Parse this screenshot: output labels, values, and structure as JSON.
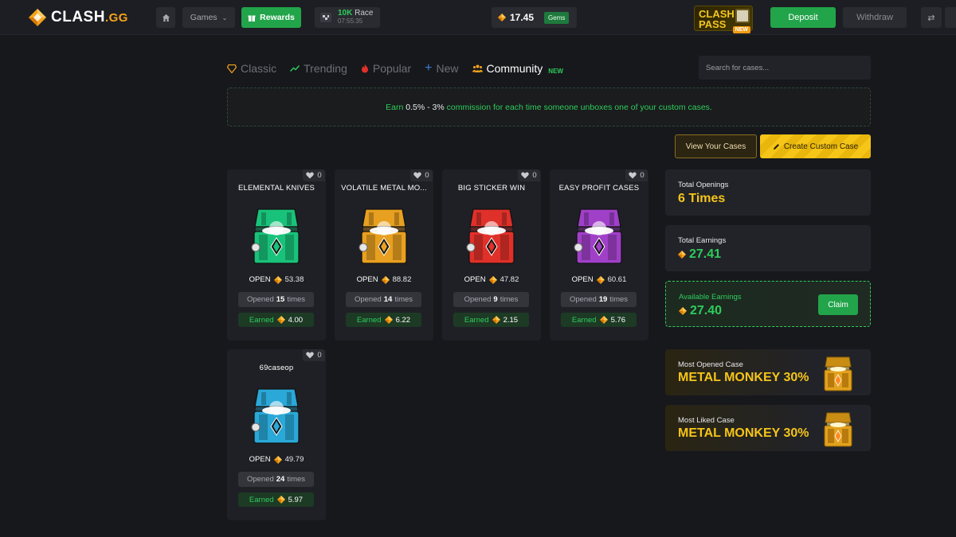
{
  "brand": {
    "name": "CLASH",
    "suffix": ".GG"
  },
  "header": {
    "games_label": "Games",
    "rewards_label": "Rewards",
    "race_prize": "10K",
    "race_label": "Race",
    "race_timer": "07:55:35",
    "balance": "17.45",
    "gems_label": "Gems",
    "pass_line1": "CLASH",
    "pass_line2": "PASS",
    "pass_new": "NEW",
    "deposit_label": "Deposit",
    "withdraw_label": "Withdraw"
  },
  "tabs": [
    {
      "label": "Classic",
      "icon": "diamond-icon",
      "active": false
    },
    {
      "label": "Trending",
      "icon": "trend-up-icon",
      "active": false
    },
    {
      "label": "Popular",
      "icon": "fire-icon",
      "active": false
    },
    {
      "label": "New",
      "icon": "plus-icon",
      "active": false
    },
    {
      "label": "Community",
      "icon": "users-icon",
      "active": true,
      "tag": "NEW"
    }
  ],
  "search": {
    "placeholder": "Search for cases..."
  },
  "banner": {
    "prefix": "Earn",
    "highlight": "0.5% - 3%",
    "suffix": "commission for each time someone unboxes one of your custom cases."
  },
  "actions": {
    "view_cases": "View Your Cases",
    "create_case": "Create Custom Case"
  },
  "cases": [
    {
      "title": "ELEMENTAL KNIVES",
      "likes": "0",
      "open_label": "OPEN",
      "price": "53.38",
      "opened_prefix": "Opened",
      "opened_count": "15",
      "opened_suffix": "times",
      "earned_label": "Earned",
      "earned": "4.00",
      "color": "#19c27a"
    },
    {
      "title": "VOLATILE METAL MO...",
      "likes": "0",
      "open_label": "OPEN",
      "price": "88.82",
      "opened_prefix": "Opened",
      "opened_count": "14",
      "opened_suffix": "times",
      "earned_label": "Earned",
      "earned": "6.22",
      "color": "#e8a020"
    },
    {
      "title": "BIG STICKER WIN",
      "likes": "0",
      "open_label": "OPEN",
      "price": "47.82",
      "opened_prefix": "Opened",
      "opened_count": "9",
      "opened_suffix": "times",
      "earned_label": "Earned",
      "earned": "2.15",
      "color": "#e0302a"
    },
    {
      "title": "EASY PROFIT CASES",
      "likes": "0",
      "open_label": "OPEN",
      "price": "60.61",
      "opened_prefix": "Opened",
      "opened_count": "19",
      "opened_suffix": "times",
      "earned_label": "Earned",
      "earned": "5.76",
      "color": "#a040c8"
    },
    {
      "title": "69caseop",
      "likes": "0",
      "open_label": "OPEN",
      "price": "49.79",
      "opened_prefix": "Opened",
      "opened_count": "24",
      "opened_suffix": "times",
      "earned_label": "Earned",
      "earned": "5.97",
      "color": "#2aa8d8"
    }
  ],
  "stats": {
    "total_openings_label": "Total Openings",
    "total_openings": "6 Times",
    "total_earnings_label": "Total Earnings",
    "total_earnings": "27.41",
    "available_label": "Available Earnings",
    "available": "27.40",
    "claim_label": "Claim",
    "most_opened_label": "Most Opened Case",
    "most_opened": "METAL MONKEY 30%",
    "most_liked_label": "Most Liked Case",
    "most_liked": "METAL MONKEY 30%"
  },
  "colors": {
    "accent_green": "#22a44a",
    "gold": "#f5c518",
    "background": "#17181c"
  }
}
